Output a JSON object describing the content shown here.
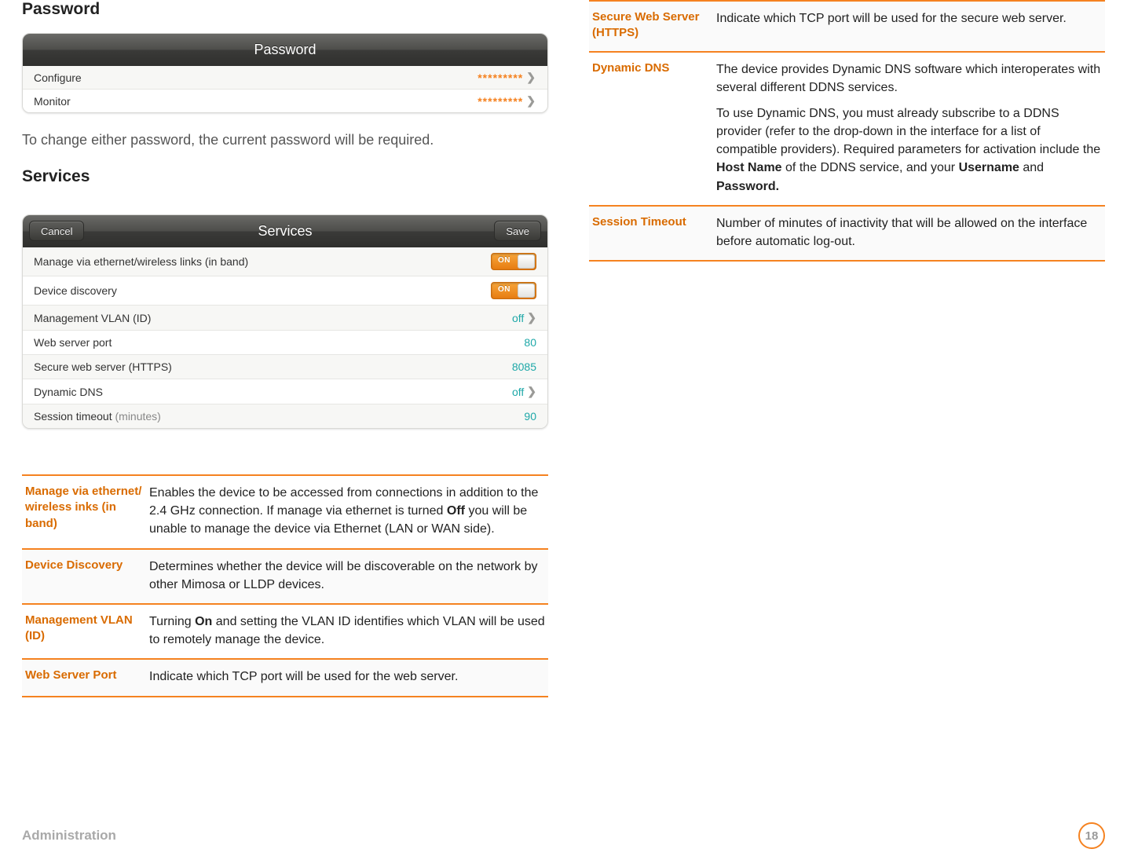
{
  "headings": {
    "password": "Password",
    "services": "Services"
  },
  "passwordPanel": {
    "title": "Password",
    "rows": [
      {
        "label": "Configure",
        "value": "*********"
      },
      {
        "label": "Monitor",
        "value": "*********"
      }
    ]
  },
  "passwordNote": "To change either password, the current password will be required.",
  "servicesPanel": {
    "title": "Services",
    "cancel": "Cancel",
    "save": "Save",
    "rows": [
      {
        "label": "Manage via ethernet/wireless links (in band)",
        "type": "toggle",
        "toggleText": "ON"
      },
      {
        "label": "Device discovery",
        "type": "toggle",
        "toggleText": "ON"
      },
      {
        "label": "Management VLAN (ID)",
        "type": "link",
        "value": "off"
      },
      {
        "label": "Web server port",
        "type": "value",
        "value": "80"
      },
      {
        "label": "Secure web server (HTTPS)",
        "type": "value",
        "value": "8085"
      },
      {
        "label": "Dynamic DNS",
        "type": "link",
        "value": "off"
      },
      {
        "label": "Session timeout",
        "labelSuffix": "(minutes)",
        "type": "value",
        "value": "90"
      }
    ]
  },
  "defsLeft": [
    {
      "term": "Manage via ethernet/ wireless inks (in band)",
      "desc": "Enables the device to be accessed from connections in addition to the 2.4 GHz connection. If manage via ethernet is turned <b>Off</b> you will be unable to manage the device via Ethernet (LAN or WAN side).",
      "alt": false
    },
    {
      "term": "Device Discovery",
      "desc": "Determines whether the device will be discoverable on the network by other Mimosa or LLDP devices.",
      "alt": true
    },
    {
      "term": "Management VLAN (ID)",
      "desc": "Turning <b>On</b> and setting the VLAN ID identifies which VLAN will be used to remotely manage the device.",
      "alt": false
    },
    {
      "term": "Web Server Port",
      "desc": "Indicate which TCP port will be used for the web server.",
      "alt": true
    }
  ],
  "defsRight": [
    {
      "term": "Secure Web Server (HTTPS)",
      "desc": "Indicate which TCP port will be used for the secure web server.",
      "alt": true
    },
    {
      "term": "Dynamic DNS",
      "descParas": [
        "The device provides Dynamic DNS software which interoperates with several different DDNS services.",
        "To use Dynamic DNS, you must already subscribe to a DDNS provider (refer to the drop-down in the interface for a list of compatible providers). Required parameters for activation include the <b>Host Name</b> of the DDNS service, and your <b>Username</b> and <b>Password.</b>"
      ],
      "alt": false
    },
    {
      "term": "Session Timeout",
      "desc": "Number of minutes of inactivity that will be allowed on the interface before automatic log-out.",
      "alt": true
    }
  ],
  "footer": {
    "section": "Administration",
    "page": "18"
  },
  "chevron": "❯"
}
